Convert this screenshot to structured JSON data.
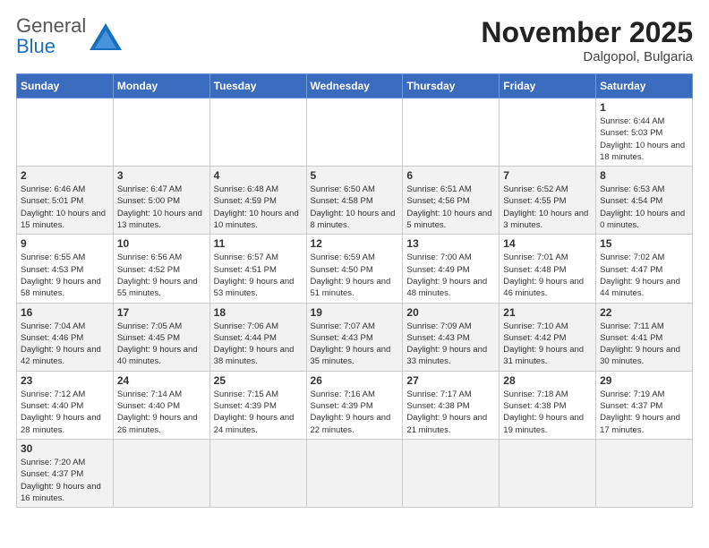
{
  "header": {
    "logo_general": "General",
    "logo_blue": "Blue",
    "month_year": "November 2025",
    "location": "Dalgopol, Bulgaria"
  },
  "weekdays": [
    "Sunday",
    "Monday",
    "Tuesday",
    "Wednesday",
    "Thursday",
    "Friday",
    "Saturday"
  ],
  "weeks": [
    [
      {
        "day": "",
        "info": ""
      },
      {
        "day": "",
        "info": ""
      },
      {
        "day": "",
        "info": ""
      },
      {
        "day": "",
        "info": ""
      },
      {
        "day": "",
        "info": ""
      },
      {
        "day": "",
        "info": ""
      },
      {
        "day": "1",
        "info": "Sunrise: 6:44 AM\nSunset: 5:03 PM\nDaylight: 10 hours and 18 minutes."
      }
    ],
    [
      {
        "day": "2",
        "info": "Sunrise: 6:46 AM\nSunset: 5:01 PM\nDaylight: 10 hours and 15 minutes."
      },
      {
        "day": "3",
        "info": "Sunrise: 6:47 AM\nSunset: 5:00 PM\nDaylight: 10 hours and 13 minutes."
      },
      {
        "day": "4",
        "info": "Sunrise: 6:48 AM\nSunset: 4:59 PM\nDaylight: 10 hours and 10 minutes."
      },
      {
        "day": "5",
        "info": "Sunrise: 6:50 AM\nSunset: 4:58 PM\nDaylight: 10 hours and 8 minutes."
      },
      {
        "day": "6",
        "info": "Sunrise: 6:51 AM\nSunset: 4:56 PM\nDaylight: 10 hours and 5 minutes."
      },
      {
        "day": "7",
        "info": "Sunrise: 6:52 AM\nSunset: 4:55 PM\nDaylight: 10 hours and 3 minutes."
      },
      {
        "day": "8",
        "info": "Sunrise: 6:53 AM\nSunset: 4:54 PM\nDaylight: 10 hours and 0 minutes."
      }
    ],
    [
      {
        "day": "9",
        "info": "Sunrise: 6:55 AM\nSunset: 4:53 PM\nDaylight: 9 hours and 58 minutes."
      },
      {
        "day": "10",
        "info": "Sunrise: 6:56 AM\nSunset: 4:52 PM\nDaylight: 9 hours and 55 minutes."
      },
      {
        "day": "11",
        "info": "Sunrise: 6:57 AM\nSunset: 4:51 PM\nDaylight: 9 hours and 53 minutes."
      },
      {
        "day": "12",
        "info": "Sunrise: 6:59 AM\nSunset: 4:50 PM\nDaylight: 9 hours and 51 minutes."
      },
      {
        "day": "13",
        "info": "Sunrise: 7:00 AM\nSunset: 4:49 PM\nDaylight: 9 hours and 48 minutes."
      },
      {
        "day": "14",
        "info": "Sunrise: 7:01 AM\nSunset: 4:48 PM\nDaylight: 9 hours and 46 minutes."
      },
      {
        "day": "15",
        "info": "Sunrise: 7:02 AM\nSunset: 4:47 PM\nDaylight: 9 hours and 44 minutes."
      }
    ],
    [
      {
        "day": "16",
        "info": "Sunrise: 7:04 AM\nSunset: 4:46 PM\nDaylight: 9 hours and 42 minutes."
      },
      {
        "day": "17",
        "info": "Sunrise: 7:05 AM\nSunset: 4:45 PM\nDaylight: 9 hours and 40 minutes."
      },
      {
        "day": "18",
        "info": "Sunrise: 7:06 AM\nSunset: 4:44 PM\nDaylight: 9 hours and 38 minutes."
      },
      {
        "day": "19",
        "info": "Sunrise: 7:07 AM\nSunset: 4:43 PM\nDaylight: 9 hours and 35 minutes."
      },
      {
        "day": "20",
        "info": "Sunrise: 7:09 AM\nSunset: 4:43 PM\nDaylight: 9 hours and 33 minutes."
      },
      {
        "day": "21",
        "info": "Sunrise: 7:10 AM\nSunset: 4:42 PM\nDaylight: 9 hours and 31 minutes."
      },
      {
        "day": "22",
        "info": "Sunrise: 7:11 AM\nSunset: 4:41 PM\nDaylight: 9 hours and 30 minutes."
      }
    ],
    [
      {
        "day": "23",
        "info": "Sunrise: 7:12 AM\nSunset: 4:40 PM\nDaylight: 9 hours and 28 minutes."
      },
      {
        "day": "24",
        "info": "Sunrise: 7:14 AM\nSunset: 4:40 PM\nDaylight: 9 hours and 26 minutes."
      },
      {
        "day": "25",
        "info": "Sunrise: 7:15 AM\nSunset: 4:39 PM\nDaylight: 9 hours and 24 minutes."
      },
      {
        "day": "26",
        "info": "Sunrise: 7:16 AM\nSunset: 4:39 PM\nDaylight: 9 hours and 22 minutes."
      },
      {
        "day": "27",
        "info": "Sunrise: 7:17 AM\nSunset: 4:38 PM\nDaylight: 9 hours and 21 minutes."
      },
      {
        "day": "28",
        "info": "Sunrise: 7:18 AM\nSunset: 4:38 PM\nDaylight: 9 hours and 19 minutes."
      },
      {
        "day": "29",
        "info": "Sunrise: 7:19 AM\nSunset: 4:37 PM\nDaylight: 9 hours and 17 minutes."
      }
    ],
    [
      {
        "day": "30",
        "info": "Sunrise: 7:20 AM\nSunset: 4:37 PM\nDaylight: 9 hours and 16 minutes."
      },
      {
        "day": "",
        "info": ""
      },
      {
        "day": "",
        "info": ""
      },
      {
        "day": "",
        "info": ""
      },
      {
        "day": "",
        "info": ""
      },
      {
        "day": "",
        "info": ""
      },
      {
        "day": "",
        "info": ""
      }
    ]
  ]
}
